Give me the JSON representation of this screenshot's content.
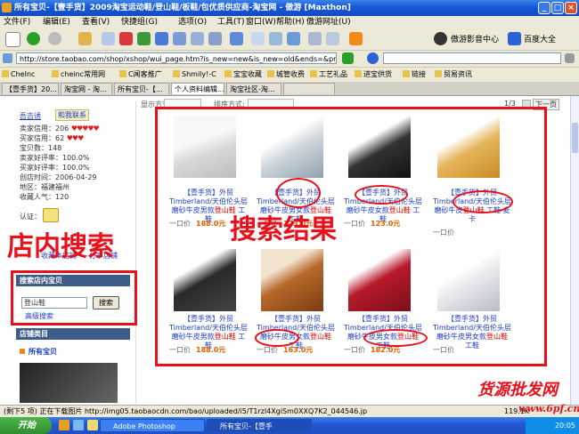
{
  "window": {
    "title": "所有宝贝-【壹手货】2009淘宝运动鞋/登山鞋/板鞋/包优质供应商-淘宝网 - 傲游 [Maxthon]",
    "min_label": "_",
    "max_label": "□",
    "close_label": "×"
  },
  "menu": [
    "文件(F)",
    "编辑(E)",
    "查看(V)",
    "快捷组(G)",
    "选项(O)",
    "工具(T)",
    "窗口(W)",
    "帮助(H)",
    "傲游网址(U)"
  ],
  "toolbar": {
    "media_center": "傲游影音中心",
    "baidu": "百度大全"
  },
  "address": {
    "url": "http://store.taobao.com/shop/xshop/wui_page.htm?is_new=new&is_new=old&ends=&price1=&price2=&search"
  },
  "favorites": [
    "CheInc",
    "cheinc常用网",
    "C闻客推广",
    "Shmily!-C",
    "宝宝收藏",
    "城管收费",
    "工艺礼品",
    "进宝供货",
    "链接",
    "贸易资讯"
  ],
  "tabs": [
    "【壹手货】20...",
    "淘宝网 - 淘...",
    "所有宝贝-【...",
    "个人资料编辑...",
    "淘宝社区-淘..."
  ],
  "page_header": {
    "display_label": "显示方式:",
    "sort_label": "排序方式:",
    "pager": "1/3",
    "next": "下一页"
  },
  "sidebar": {
    "seller": "吾吉诱",
    "contact": "和我联系",
    "stats": [
      {
        "label": "卖家信用：",
        "value": "206",
        "hearts": "♥♥♥♥♥"
      },
      {
        "label": "买家信用：",
        "value": "62",
        "hearts": "♥♥♥"
      },
      {
        "label": "宝贝数：",
        "value": "148"
      },
      {
        "label": "卖家好评率：",
        "value": "100.0%"
      },
      {
        "label": "买家好评率：",
        "value": "100.0%"
      },
      {
        "label": "创店时间：",
        "value": "2006-04-29"
      },
      {
        "label": "地区：",
        "value": "福建福州"
      },
      {
        "label": "收藏人气：",
        "value": "120"
      }
    ],
    "cert": "认证：",
    "add_fav": "收藏本店铺",
    "link_label": "分享店铺",
    "search_head": "搜索店内宝贝",
    "search_value": "登山鞋",
    "search_btn": "搜索",
    "adv_search": "高级搜索",
    "category_head": "店铺类目",
    "all_items": "所有宝贝"
  },
  "chart_data": {
    "type": "table",
    "products": [
      {
        "title_a": "【壹手货】外贸Timberland/天伯伦头层磨砂牛皮男款",
        "title_hl": "登山鞋",
        "title_b": " 工鞋",
        "price": "188.0元",
        "price_label": "一口价"
      },
      {
        "title_a": "【壹手货】外贸Timberland/天伯伦头层磨砂牛皮男女款",
        "title_hl": "登山鞋",
        "title_b": " 工鞋",
        "price": "123.0元",
        "price_label": "一口价"
      },
      {
        "title_a": "【壹手货】外贸Timberland/天伯伦头层磨砂牛皮女款",
        "title_hl": "登山鞋",
        "title_b": " 工鞋",
        "price": "123.0元",
        "price_label": "一口价"
      },
      {
        "title_a": "【壹手货】外贸Timberland/天伯伦头层磨砂牛皮",
        "title_hl": "登山鞋",
        "title_b": " 工鞋 麦卡",
        "price": "",
        "price_label": "一口价"
      },
      {
        "title_a": "【壹手货】外贸Timberland/天伯伦头层磨砂牛皮男款",
        "title_hl": "登山鞋",
        "title_b": " 工鞋",
        "price": "188.0元",
        "price_label": "一口价"
      },
      {
        "title_a": "【壹手货】外贸Timberland/天伯伦头层磨砂牛皮男女款",
        "title_hl": "登山鞋",
        "title_b": " 工鞋",
        "price": "163.0元",
        "price_label": "一口价"
      },
      {
        "title_a": "【壹手货】外贸Timberland/天伯伦头层磨砂牛皮男女款",
        "title_hl": "登山鞋",
        "title_b": " 工鞋",
        "price": "182.0元",
        "price_label": "一口价"
      },
      {
        "title_a": "【壹手货】外贸Timberland/天伯伦头层磨砂牛皮男女款",
        "title_hl": "登山鞋",
        "title_b": " 工鞋",
        "price": "",
        "price_label": "一口价"
      }
    ]
  },
  "annotations": {
    "store_search": "店内搜索",
    "search_results": "搜索结果"
  },
  "status": {
    "left": "(剩下5 项) 正在下载图片 http://img05.taobaocdn.com/bao/uploaded/i5/T1rzl4XgiSm0XXQ7K2_044546.jp",
    "speed": "119.1K"
  },
  "taskbar": {
    "start": "开始",
    "tasks": [
      "Adobe Photoshop",
      "所有宝贝-【壹手"
    ],
    "clock": "20:05"
  },
  "watermark": {
    "text": "货源批发网",
    "domain": "www.6pf.cn"
  },
  "colors": {
    "title_blue": "#1758d6",
    "annotation_red": "#e8101a",
    "link_blue": "#1a3cc9",
    "price_orange": "#e06000"
  }
}
